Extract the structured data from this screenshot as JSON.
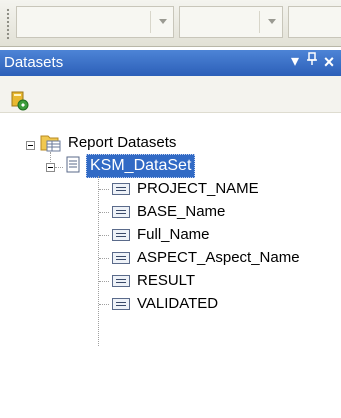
{
  "panel": {
    "title": "Datasets",
    "pin_glyph": "┰",
    "close_glyph": "×",
    "dropdown_glyph": "▾"
  },
  "toolbar": {
    "combos": [
      "",
      "",
      ""
    ]
  },
  "subtoolbar": {
    "add_icon": "add-dataset-icon"
  },
  "tree": {
    "root": {
      "label": "Report Datasets",
      "icon": "datasets-folder-icon"
    },
    "dataset": {
      "label": "KSM_DataSet",
      "icon": "dataset-table-icon"
    },
    "fields": [
      "PROJECT_NAME",
      "BASE_Name",
      "Full_Name",
      "ASPECT_Aspect_Name",
      "RESULT",
      "VALIDATED"
    ]
  }
}
